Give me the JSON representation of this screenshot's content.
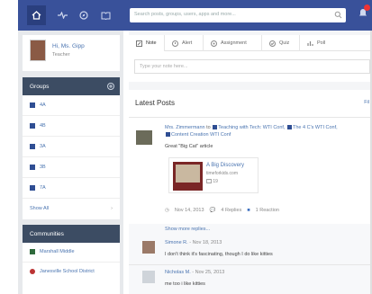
{
  "nav": {
    "search_placeholder": "Search posts, groups, users, apps and more..."
  },
  "profile": {
    "name": "Hi, Ms. Gipp",
    "role": "Teacher"
  },
  "groups": {
    "title": "Groups",
    "items": [
      "4A",
      "4B",
      "3A",
      "3B",
      "7A"
    ],
    "show_all": "Show All"
  },
  "communities": {
    "title": "Communities",
    "items": [
      "Marshall Middle",
      "Janesville School District"
    ]
  },
  "composer": {
    "tabs": [
      "Note",
      "Alert",
      "Assignment",
      "Quiz",
      "Poll"
    ],
    "placeholder": "Type your note here..."
  },
  "feed": {
    "title": "Latest Posts",
    "filter": "Fil",
    "post": {
      "author": "Mrs. Zimmermann",
      "to": "to",
      "group1": "Teaching with Tech: WTI Conf,",
      "group2": "The 4 C's WTI Conf,",
      "group3": "Content Creation WTI Conf",
      "text": "Great \"Big Cat\" article",
      "link_title": "A Big Discovery",
      "link_url": "timeforkids.com",
      "link_stat": "19",
      "date": "Nov 14, 2013",
      "replies": "4 Replies",
      "reactions": "1 Reaction"
    },
    "show_more": "Show more replies...",
    "comments": [
      {
        "name": "Simone R.",
        "date": "- Nov 18, 2013",
        "text": "I don't think it's fascinating, though I do like kitties"
      },
      {
        "name": "Nicholas M.",
        "date": "- Nov 25, 2013",
        "text": "me too i like kitties"
      }
    ]
  },
  "colors": {
    "nav": "#39519a",
    "sidebar_head": "#3c4c63",
    "link": "#4a74b0"
  }
}
